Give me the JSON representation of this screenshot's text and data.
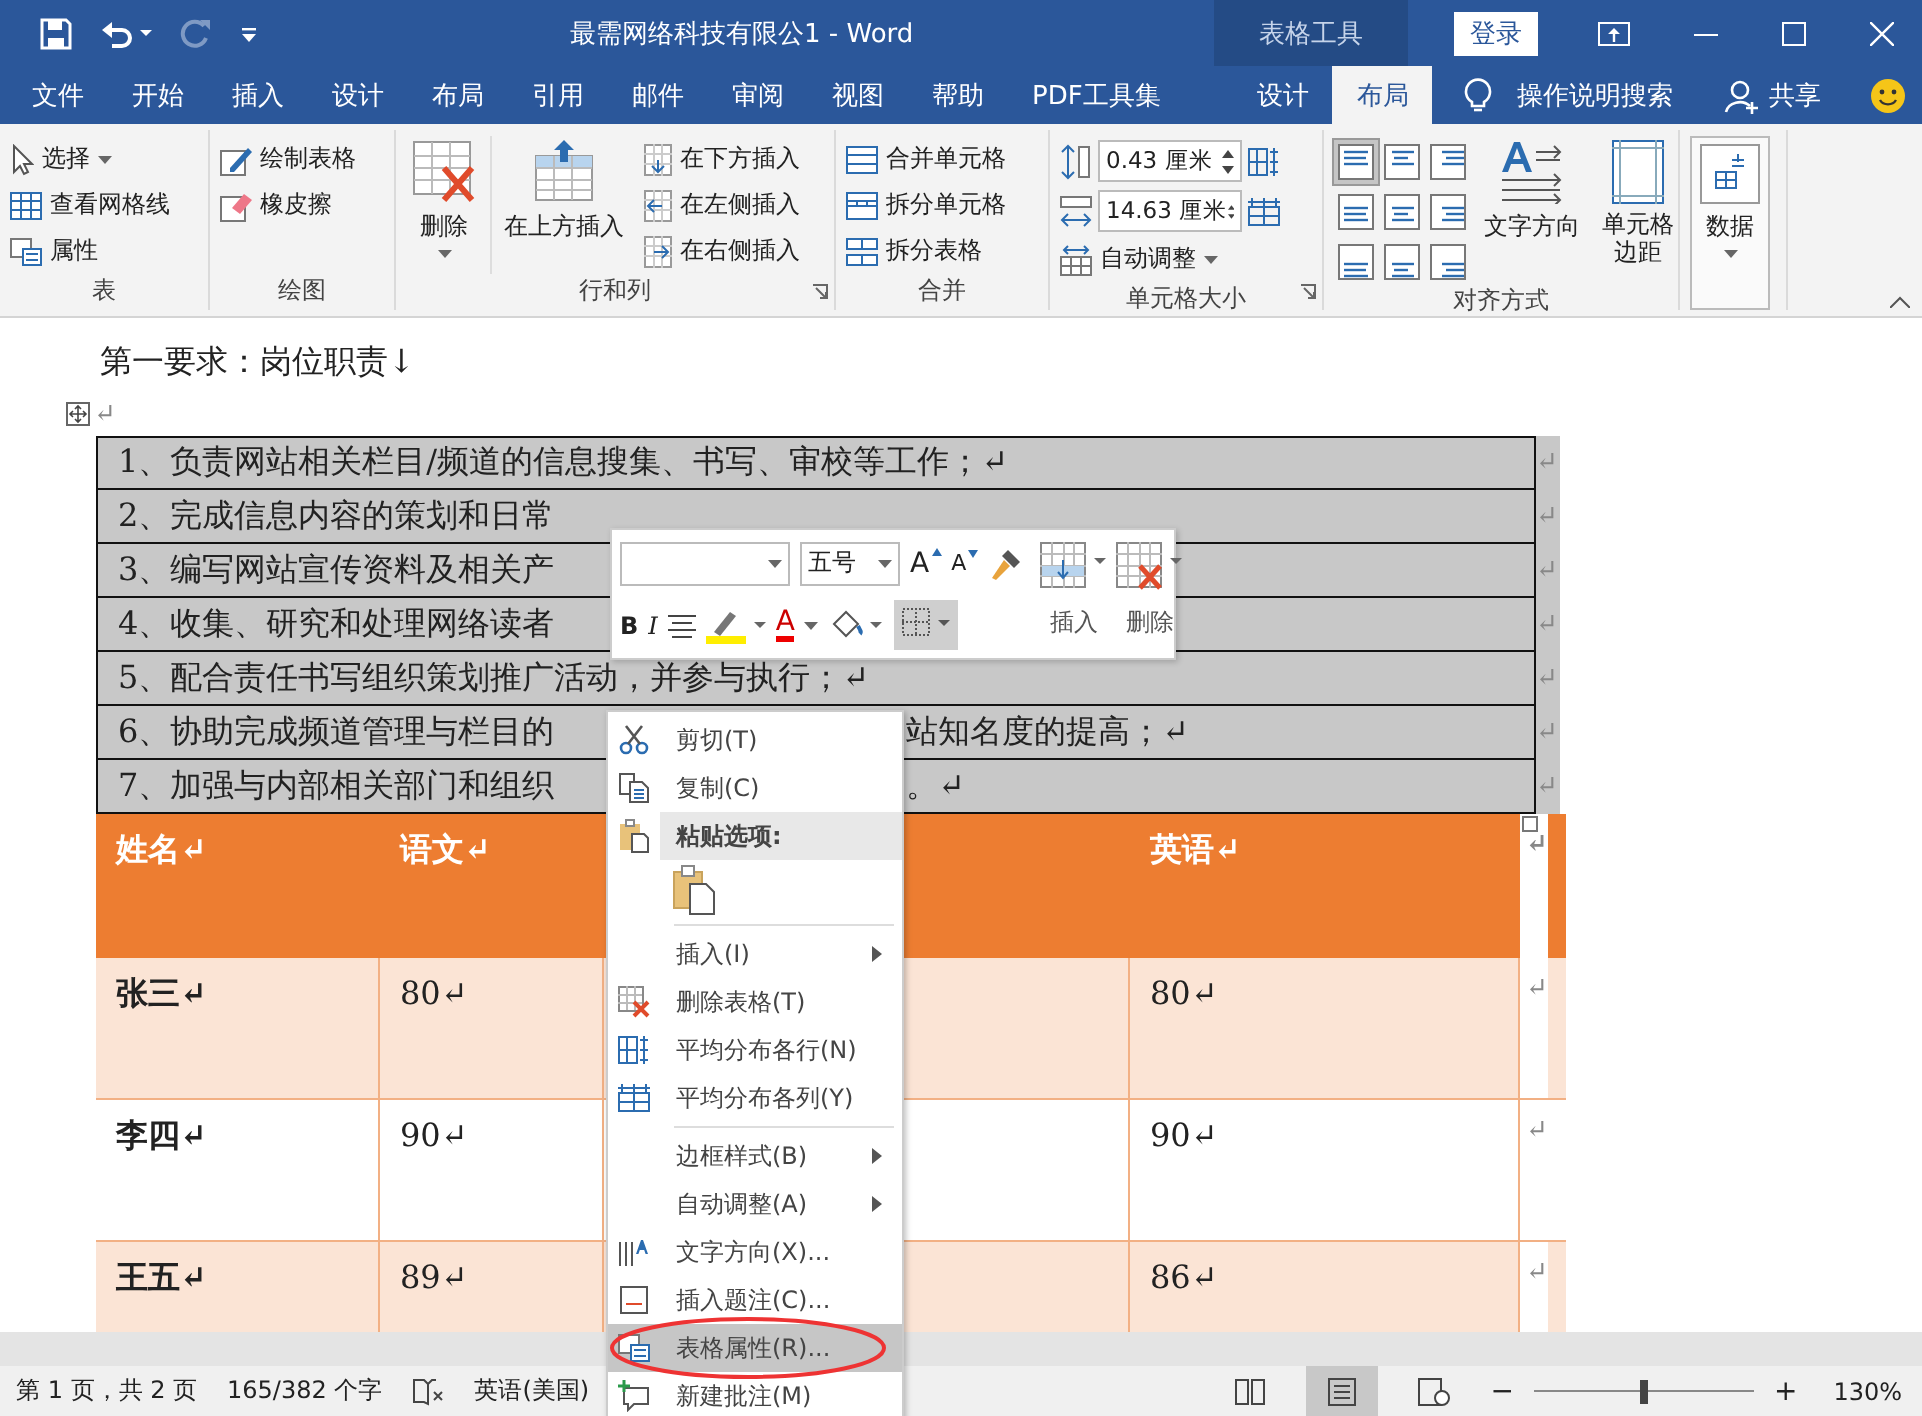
{
  "title_bar": {
    "document_title": "最需网络科技有限公1  -  Word",
    "contextual_title": "表格工具",
    "sign_in": "登录",
    "redo": {
      "disabled": true
    }
  },
  "ribbon_tabs": [
    {
      "label": "文件",
      "selected": false
    },
    {
      "label": "开始",
      "selected": false
    },
    {
      "label": "插入",
      "selected": false
    },
    {
      "label": "设计",
      "selected": false
    },
    {
      "label": "布局",
      "selected": false
    },
    {
      "label": "引用",
      "selected": false
    },
    {
      "label": "邮件",
      "selected": false
    },
    {
      "label": "审阅",
      "selected": false
    },
    {
      "label": "视图",
      "selected": false
    },
    {
      "label": "帮助",
      "selected": false
    },
    {
      "label": "PDF工具集",
      "selected": false
    },
    {
      "label": "设计",
      "selected": false
    },
    {
      "label": "布局",
      "selected": true
    }
  ],
  "tell_me": "操作说明搜索",
  "share": "共享",
  "ribbon": {
    "table_group": {
      "label": "表",
      "select": "选择",
      "view_gridlines": "查看网格线",
      "properties": "属性"
    },
    "draw_group": {
      "label": "绘图",
      "draw_table": "绘制表格",
      "eraser": "橡皮擦"
    },
    "rows_columns_group": {
      "label": "行和列",
      "delete": "删除",
      "insert_above": "在上方插入",
      "insert_below": "在下方插入",
      "insert_left": "在左侧插入",
      "insert_right": "在右侧插入"
    },
    "merge_group": {
      "label": "合并",
      "merge_cells": "合并单元格",
      "split_cells": "拆分单元格",
      "split_table": "拆分表格"
    },
    "cell_size_group": {
      "label": "单元格大小",
      "height": "0.43 厘米",
      "width": "14.63 厘米",
      "autofit": "自动调整"
    },
    "alignment_group": {
      "label": "对齐方式",
      "alignments": [
        {
          "selected": true
        },
        {
          "selected": false
        },
        {
          "selected": false
        },
        {
          "selected": false
        },
        {
          "selected": false
        },
        {
          "selected": false
        },
        {
          "selected": false
        },
        {
          "selected": false
        },
        {
          "selected": false
        }
      ],
      "text_direction": "文字方向",
      "cell_margins": "单元格边距"
    },
    "data_group": {
      "data": "数据"
    }
  },
  "document": {
    "line": "第一要求：岗位职责↓",
    "paragraph_mark": "↵",
    "duties": [
      {
        "left": "1、负责网站相关栏目/频道的信息搜集、书写、审校等工作；↵",
        "end": "↵"
      },
      {
        "left": "2、完成信息内容的策划和日常",
        "end": "↵"
      },
      {
        "left": "3、编写网站宣传资料及相关产",
        "end": "↵"
      },
      {
        "left": "4、收集、研究和处理网络读者",
        "end": "↵"
      },
      {
        "left": "5、配合责任书写组织策划推广活动，并参与执行；↵",
        "end": "↵"
      },
      {
        "left": "6、协助完成频道管理与栏目的",
        "right": "站知名度的提高；↵",
        "end": "↵"
      },
      {
        "left": "7、加强与内部相关部门和组织",
        "right": "。↵",
        "end": "↵"
      }
    ],
    "scores": {
      "columns": [
        "姓名↵",
        "语文↵",
        "英语↵"
      ],
      "header_end": "↵",
      "rows": [
        {
          "cells": [
            "张三↵",
            "80↵",
            "80↵"
          ],
          "shaded": true,
          "end": "↵"
        },
        {
          "cells": [
            "李四↵",
            "90↵",
            "90↵"
          ],
          "shaded": false,
          "end": "↵"
        },
        {
          "cells": [
            "王五↵",
            "89↵",
            "86↵"
          ],
          "shaded": true,
          "end": "↵"
        }
      ]
    }
  },
  "mini_toolbar": {
    "font_size": "五号",
    "grow_font": "A",
    "shrink_font": "A",
    "bold": "B",
    "italic": "I",
    "font_color": "A",
    "borders": {
      "selected": true
    },
    "insert": "插入",
    "delete": "删除"
  },
  "context_menu": {
    "items": [
      {
        "kind": "item",
        "label": "剪切(T)",
        "submenu": false,
        "selected": false,
        "circled": false
      },
      {
        "kind": "item",
        "label": "复制(C)",
        "submenu": false,
        "selected": false,
        "circled": false
      },
      {
        "kind": "header",
        "label": "粘贴选项:"
      },
      {
        "kind": "paste_options"
      },
      {
        "kind": "separator"
      },
      {
        "kind": "item",
        "label": "插入(I)",
        "submenu": true,
        "selected": false,
        "circled": false
      },
      {
        "kind": "item",
        "label": "删除表格(T)",
        "submenu": false,
        "selected": false,
        "circled": false
      },
      {
        "kind": "item",
        "label": "平均分布各行(N)",
        "submenu": false,
        "selected": false,
        "circled": false
      },
      {
        "kind": "item",
        "label": "平均分布各列(Y)",
        "submenu": false,
        "selected": false,
        "circled": false
      },
      {
        "kind": "separator"
      },
      {
        "kind": "item",
        "label": "边框样式(B)",
        "submenu": true,
        "selected": false,
        "circled": false
      },
      {
        "kind": "item",
        "label": "自动调整(A)",
        "submenu": true,
        "selected": false,
        "circled": false
      },
      {
        "kind": "item",
        "label": "文字方向(X)...",
        "submenu": false,
        "selected": false,
        "circled": false
      },
      {
        "kind": "item",
        "label": "插入题注(C)...",
        "submenu": false,
        "selected": false,
        "circled": false
      },
      {
        "kind": "item",
        "label": "表格属性(R)...",
        "submenu": false,
        "selected": true,
        "circled": true
      },
      {
        "kind": "item",
        "label": "新建批注(M)",
        "submenu": false,
        "selected": false,
        "circled": false
      }
    ]
  },
  "status_bar": {
    "page": "第 1 页，共 2 页",
    "words": "165/382 个字",
    "language": "英语(美国)",
    "views": [
      {
        "selected": false
      },
      {
        "selected": true
      },
      {
        "selected": false
      }
    ],
    "zoom_out": "−",
    "zoom_in": "+",
    "zoom_slider": {
      "level": 0.5
    },
    "zoom": "130%"
  }
}
